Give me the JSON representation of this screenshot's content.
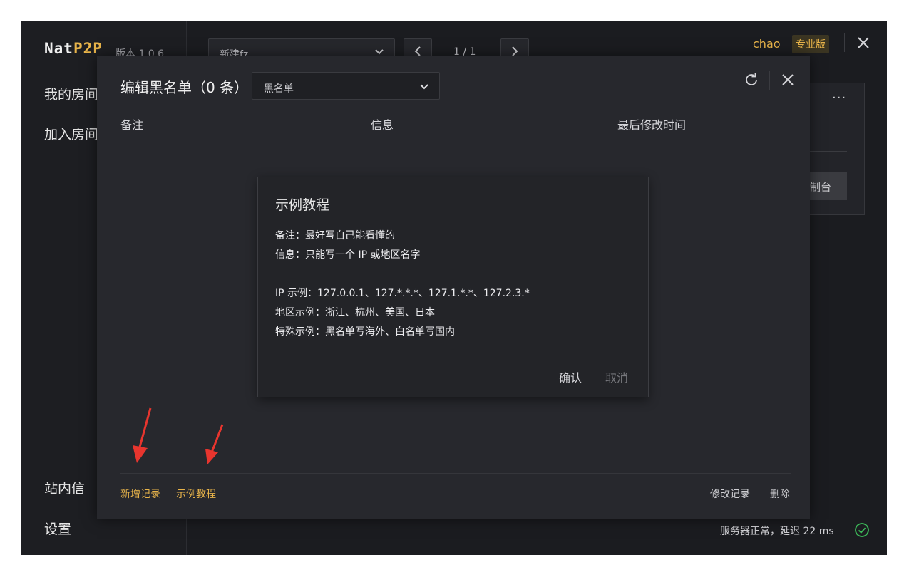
{
  "app": {
    "brand_nat": "Nat",
    "brand_p2p": "P2P",
    "version": "版本 1.0.6"
  },
  "sidebar": {
    "items": [
      {
        "label": "我的房间"
      },
      {
        "label": "加入房间"
      },
      {
        "label": "站内信"
      },
      {
        "label": "设置"
      }
    ]
  },
  "topbar": {
    "room_select": "新建fz",
    "page_indicator": "1 / 1",
    "user_name": "chao",
    "plan_badge": "专业版"
  },
  "background_card": {
    "more": "···",
    "button_fragment": "制台"
  },
  "status": {
    "text": "服务器正常，延迟 22 ms"
  },
  "dialog": {
    "title": "编辑黑名单（0 条）",
    "list_type_select": "黑名单",
    "columns": [
      "备注",
      "信息",
      "最后修改时间"
    ],
    "footer_left": {
      "add": "新增记录",
      "tutorial": "示例教程"
    },
    "footer_right": {
      "edit": "修改记录",
      "delete": "删除"
    }
  },
  "popup": {
    "title": "示例教程",
    "lines": [
      "备注：最好写自己能看懂的",
      "信息：只能写一个 IP 或地区名字",
      "IP 示例：127.0.0.1、127.*.*.*、127.1.*.*、127.2.3.*",
      "地区示例：浙江、杭州、美国、日本",
      "特殊示例：黑名单写海外、白名单写国内"
    ],
    "confirm": "确认",
    "cancel": "取消"
  },
  "colors": {
    "accent": "#e8b44a",
    "background": "#1b1c20",
    "dialog_bg": "#27282d",
    "annotation_arrow": "#e8352e",
    "status_ok": "#3dbb5a"
  },
  "icons": [
    "chevron-down-icon",
    "chevron-left-icon",
    "chevron-right-icon",
    "close-icon",
    "refresh-icon",
    "check-circle-icon",
    "annotation-arrow-icon"
  ]
}
